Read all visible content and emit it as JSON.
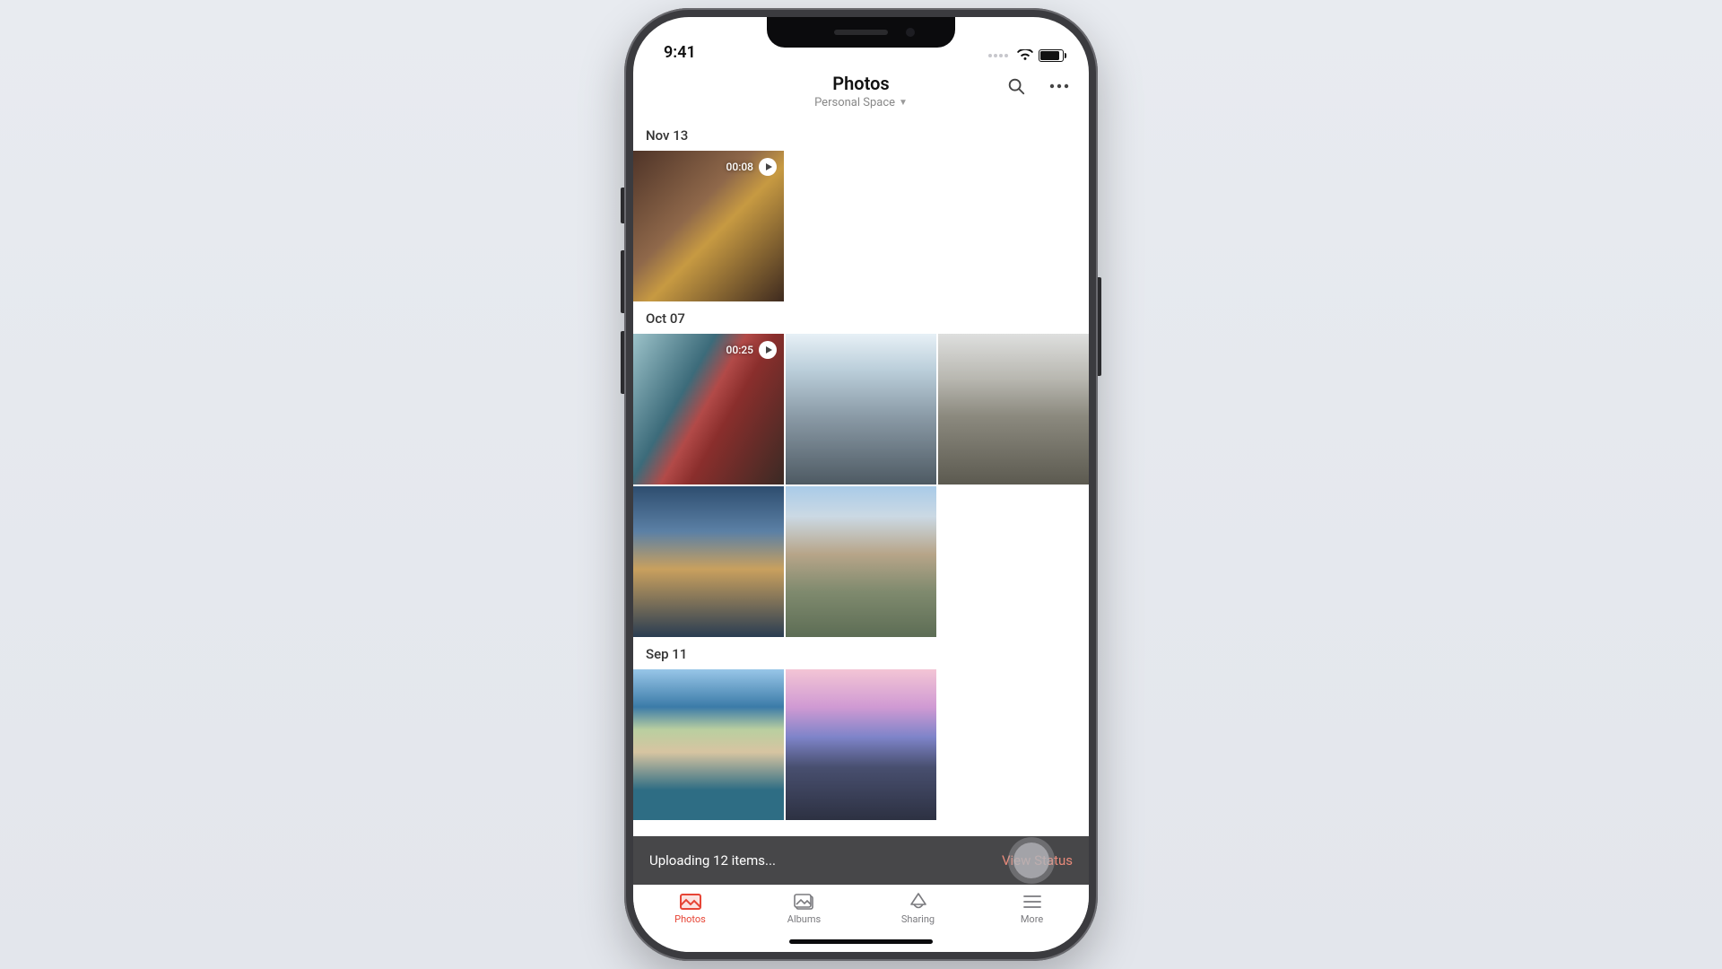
{
  "status": {
    "time": "9:41"
  },
  "header": {
    "title": "Photos",
    "subtitle": "Personal Space"
  },
  "sections": [
    {
      "date": "Nov 13",
      "items": [
        {
          "type": "video",
          "duration": "00:08"
        }
      ]
    },
    {
      "date": "Oct 07",
      "items": [
        {
          "type": "video",
          "duration": "00:25"
        },
        {
          "type": "photo"
        },
        {
          "type": "photo"
        },
        {
          "type": "photo"
        },
        {
          "type": "photo"
        }
      ]
    },
    {
      "date": "Sep 11",
      "items": [
        {
          "type": "photo"
        },
        {
          "type": "photo"
        }
      ]
    }
  ],
  "upload": {
    "status": "Uploading 12 items...",
    "action": "View Status"
  },
  "tabs": {
    "photos": "Photos",
    "albums": "Albums",
    "sharing": "Sharing",
    "more": "More"
  }
}
